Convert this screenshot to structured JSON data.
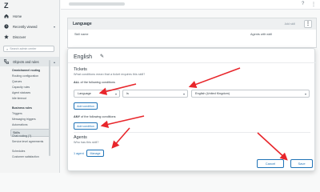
{
  "sidebar": {
    "logo_glyph": "Z",
    "items": [
      {
        "label": "Home",
        "icon": "home-icon"
      },
      {
        "label": "Recently viewed",
        "icon": "clock-icon"
      },
      {
        "label": "Discover",
        "icon": "star-icon"
      }
    ],
    "search_placeholder": "Search admin center",
    "objects_label": "Objects and rules",
    "sections": [
      {
        "heading": "Omnichannel routing",
        "items": [
          "Routing configuration",
          "Queues",
          "Capacity rules",
          "Agent statuses",
          "Idle timeout"
        ]
      },
      {
        "heading": "Business rules",
        "items": [
          "Triggers",
          "Messaging triggers",
          "Automations",
          "Skills",
          "Chat routing (?)",
          "Service level agreements",
          "Schedules",
          "Customer satisfaction"
        ]
      }
    ],
    "selected_item": "Skills"
  },
  "background_card": {
    "title": "Language",
    "action": "Add skill",
    "columns": [
      "Skill name",
      "Agents with skill"
    ]
  },
  "modal": {
    "title": "English",
    "edit_glyph": "✎",
    "tickets_heading": "Tickets",
    "tickets_sub": "What conditions mean that a ticket requires this skill?",
    "all_label_bold": "ALL",
    "all_label_rest": " of the following conditions",
    "condition": {
      "field": "Language",
      "operator": "Is",
      "value": "English (United Kingdom)"
    },
    "add_condition_label": "Add condition",
    "any_label_bold": "ANY",
    "any_label_rest": " of the following conditions",
    "agents_heading": "Agents",
    "agents_sub": "Who has this skill?",
    "agents_count": "1 agent",
    "manage_label": "Manage",
    "cancel_label": "Cancel",
    "save_label": "Save"
  },
  "colors": {
    "accent": "#1f73b7",
    "arrow": "#e8262b",
    "sidebar_bg": "#f3f4f4"
  }
}
